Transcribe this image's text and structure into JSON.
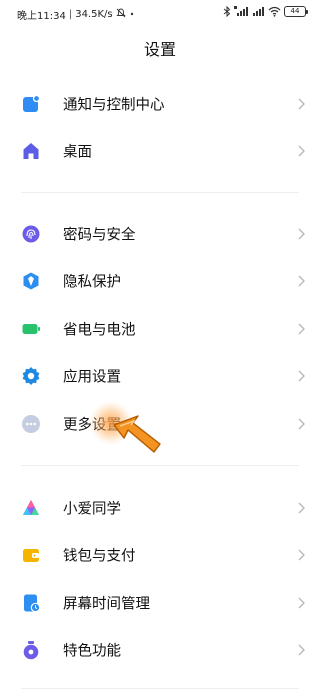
{
  "status_bar": {
    "time": "晚上11:34",
    "separator": "|",
    "speed": "34.5K/s",
    "battery": "44"
  },
  "header": {
    "title": "设置"
  },
  "groups": [
    {
      "items": [
        {
          "label": "通知与控制中心",
          "icon": "notification-icon",
          "color": "#2f8cf5"
        },
        {
          "label": "桌面",
          "icon": "home-icon",
          "color": "#5c5ce6"
        }
      ]
    },
    {
      "items": [
        {
          "label": "密码与安全",
          "icon": "fingerprint-icon",
          "color": "#6c5ce7"
        },
        {
          "label": "隐私保护",
          "icon": "privacy-shield-icon",
          "color": "#2c8ef0"
        },
        {
          "label": "省电与电池",
          "icon": "battery-icon",
          "color": "#27c26b"
        },
        {
          "label": "应用设置",
          "icon": "gear-icon",
          "color": "#1e88e5"
        },
        {
          "label": "更多设置",
          "icon": "more-dots-icon",
          "color": "#9aa6c8"
        }
      ]
    },
    {
      "items": [
        {
          "label": "小爱同学",
          "icon": "xiaoai-icon",
          "color": "#8e63f5"
        },
        {
          "label": "钱包与支付",
          "icon": "wallet-icon",
          "color": "#f5b400"
        },
        {
          "label": "屏幕时间管理",
          "icon": "screen-time-icon",
          "color": "#2c8ef0"
        },
        {
          "label": "特色功能",
          "icon": "feature-icon",
          "color": "#6c5ce7"
        }
      ]
    }
  ]
}
